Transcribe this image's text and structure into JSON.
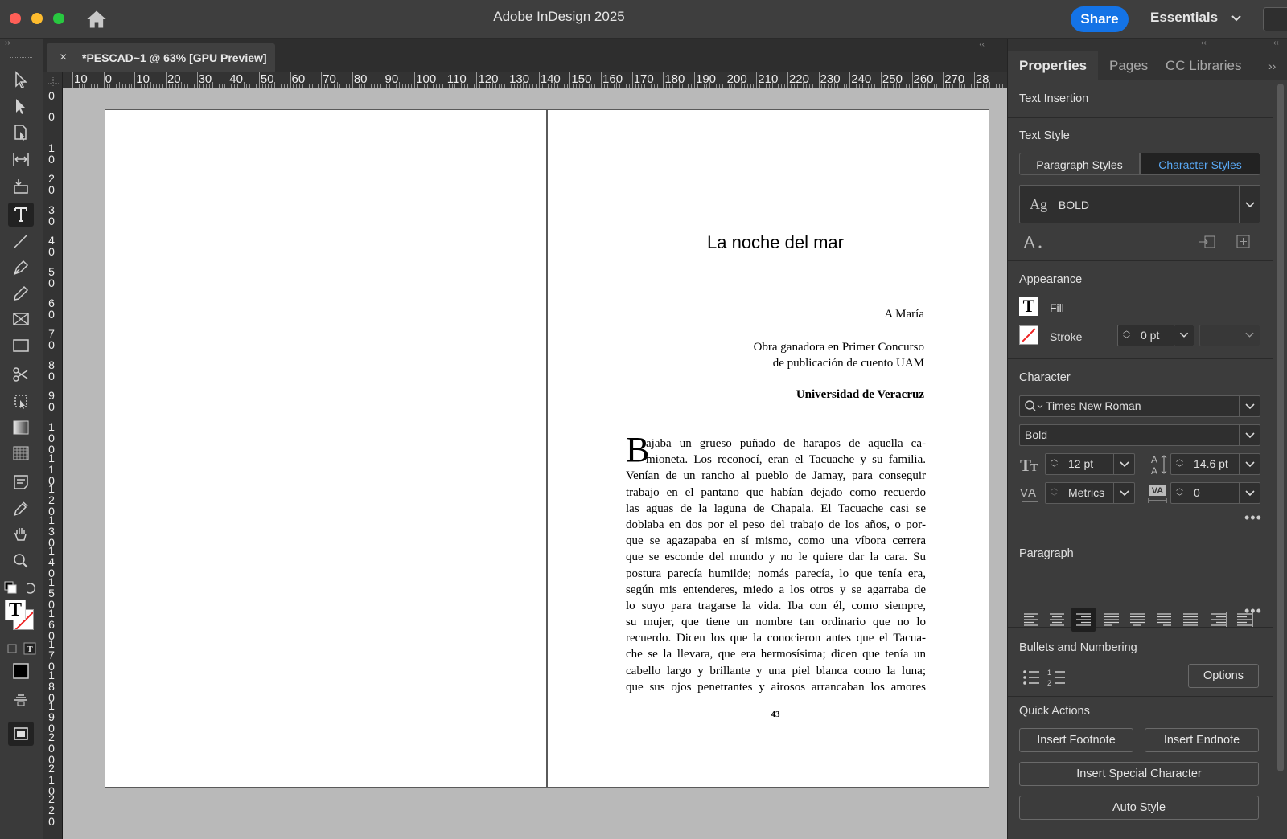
{
  "app": {
    "title": "Adobe InDesign 2025",
    "share_label": "Share",
    "workspace_label": "Essentials"
  },
  "document_tab": {
    "close_glyph": "×",
    "title": "*PESCAD~1 @ 63% [GPU Preview]"
  },
  "ruler_h_labels": [
    "10",
    "0",
    "10",
    "20",
    "30",
    "40",
    "50",
    "60",
    "70",
    "80",
    "90",
    "100",
    "110",
    "120",
    "130",
    "140",
    "150",
    "160",
    "170",
    "180",
    "190",
    "200",
    "210",
    "220",
    "230",
    "240",
    "250",
    "260",
    "270",
    "28"
  ],
  "ruler_v_labels": [
    "0",
    "0",
    "10",
    "20",
    "30",
    "40",
    "50",
    "60",
    "70",
    "80",
    "90",
    "100",
    "110",
    "120",
    "130",
    "140",
    "150",
    "160",
    "170",
    "180",
    "190",
    "200",
    "210",
    "220"
  ],
  "page": {
    "title": "La noche del mar",
    "dedication": "A María",
    "award_line1": "Obra ganadora en Primer Concurso",
    "award_line2": "de publicación de cuento UAM",
    "university": "Universidad de Veracruz",
    "dropcap": "B",
    "body_lines": [
      "ajaba un grueso puñado de harapos de aquella ca-",
      "mioneta. Los reconocí, eran el Tacuache y su familia.",
      "Venían de un rancho al pueblo de Jamay, para conseguir",
      "trabajo en el pantano que habían dejado como recuerdo",
      "las aguas de la laguna de Chapala. El Tacuache casi se",
      "doblaba en dos por el peso del trabajo de los años, o por-",
      "que se agazapaba en sí mismo, como una víbora cerrera",
      "que se esconde del mundo y no le quiere dar la cara. Su",
      "postura parecía humilde; nomás parecía, lo que tenía era,",
      "según mis entenderes, miedo a los otros y se agarraba de",
      "lo suyo para tragarse la vida. Iba con él, como siempre,",
      "su mujer, que tiene un nombre tan ordinario que no lo",
      "recuerdo. Dicen los que la conocieron antes que el Tacua-",
      "che se la llevara, que era hermosísima; dicen que tenía un",
      "cabello largo y brillante y una piel blanca como la luna;",
      "que sus ojos penetrantes y airosos arrancaban los amores"
    ],
    "page_number": "43"
  },
  "panel": {
    "tabs": [
      "Properties",
      "Pages",
      "CC Libraries"
    ],
    "text_insertion": "Text Insertion",
    "text_style": {
      "title": "Text Style",
      "paragraph_styles": "Paragraph Styles",
      "character_styles": "Character Styles",
      "style_prefix": "Ag",
      "selected_style": "BOLD"
    },
    "appearance": {
      "title": "Appearance",
      "fill_label": "Fill",
      "stroke_label": "Stroke",
      "stroke_weight": "0 pt"
    },
    "character": {
      "title": "Character",
      "font_family": "Times New Roman",
      "font_style": "Bold",
      "font_size": "12 pt",
      "leading": "14.6 pt",
      "kerning": "Metrics",
      "tracking": "0"
    },
    "paragraph": {
      "title": "Paragraph",
      "active_alignment_index": 2
    },
    "bullets": {
      "title": "Bullets and Numbering",
      "options_label": "Options"
    },
    "quick_actions": {
      "title": "Quick Actions",
      "insert_footnote": "Insert Footnote",
      "insert_endnote": "Insert Endnote",
      "insert_special_character": "Insert Special Character",
      "auto_style": "Auto Style"
    }
  },
  "colors": {
    "accent": "#1473e6",
    "active_tab_text": "#5aa9f5"
  }
}
